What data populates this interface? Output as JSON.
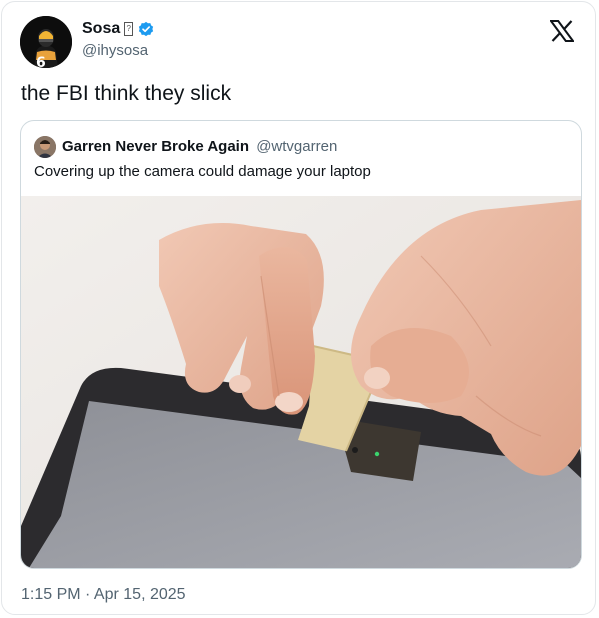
{
  "post": {
    "author": {
      "name": "Sosa",
      "name_glyph": "?",
      "handle": "@ihysosa",
      "verified": true,
      "avatar_icon": "avatar-football-player-icon",
      "avatar_jersey_number": "6"
    },
    "text": "the FBI think they slick",
    "timestamp": "1:15 PM · Apr 15, 2025",
    "platform_logo": "x-logo-icon",
    "colors": {
      "verified": "#1d9bf0",
      "secondary_text": "#536471",
      "primary_text": "#0f1419",
      "border": "#cfd9de"
    }
  },
  "quoted_post": {
    "author": {
      "name": "Garren Never Broke Again",
      "handle": "@wtvgarren",
      "avatar_icon": "avatar-person-icon"
    },
    "text": "Covering up the camera could damage your laptop",
    "image": "photo-hands-taping-laptop-webcam"
  }
}
